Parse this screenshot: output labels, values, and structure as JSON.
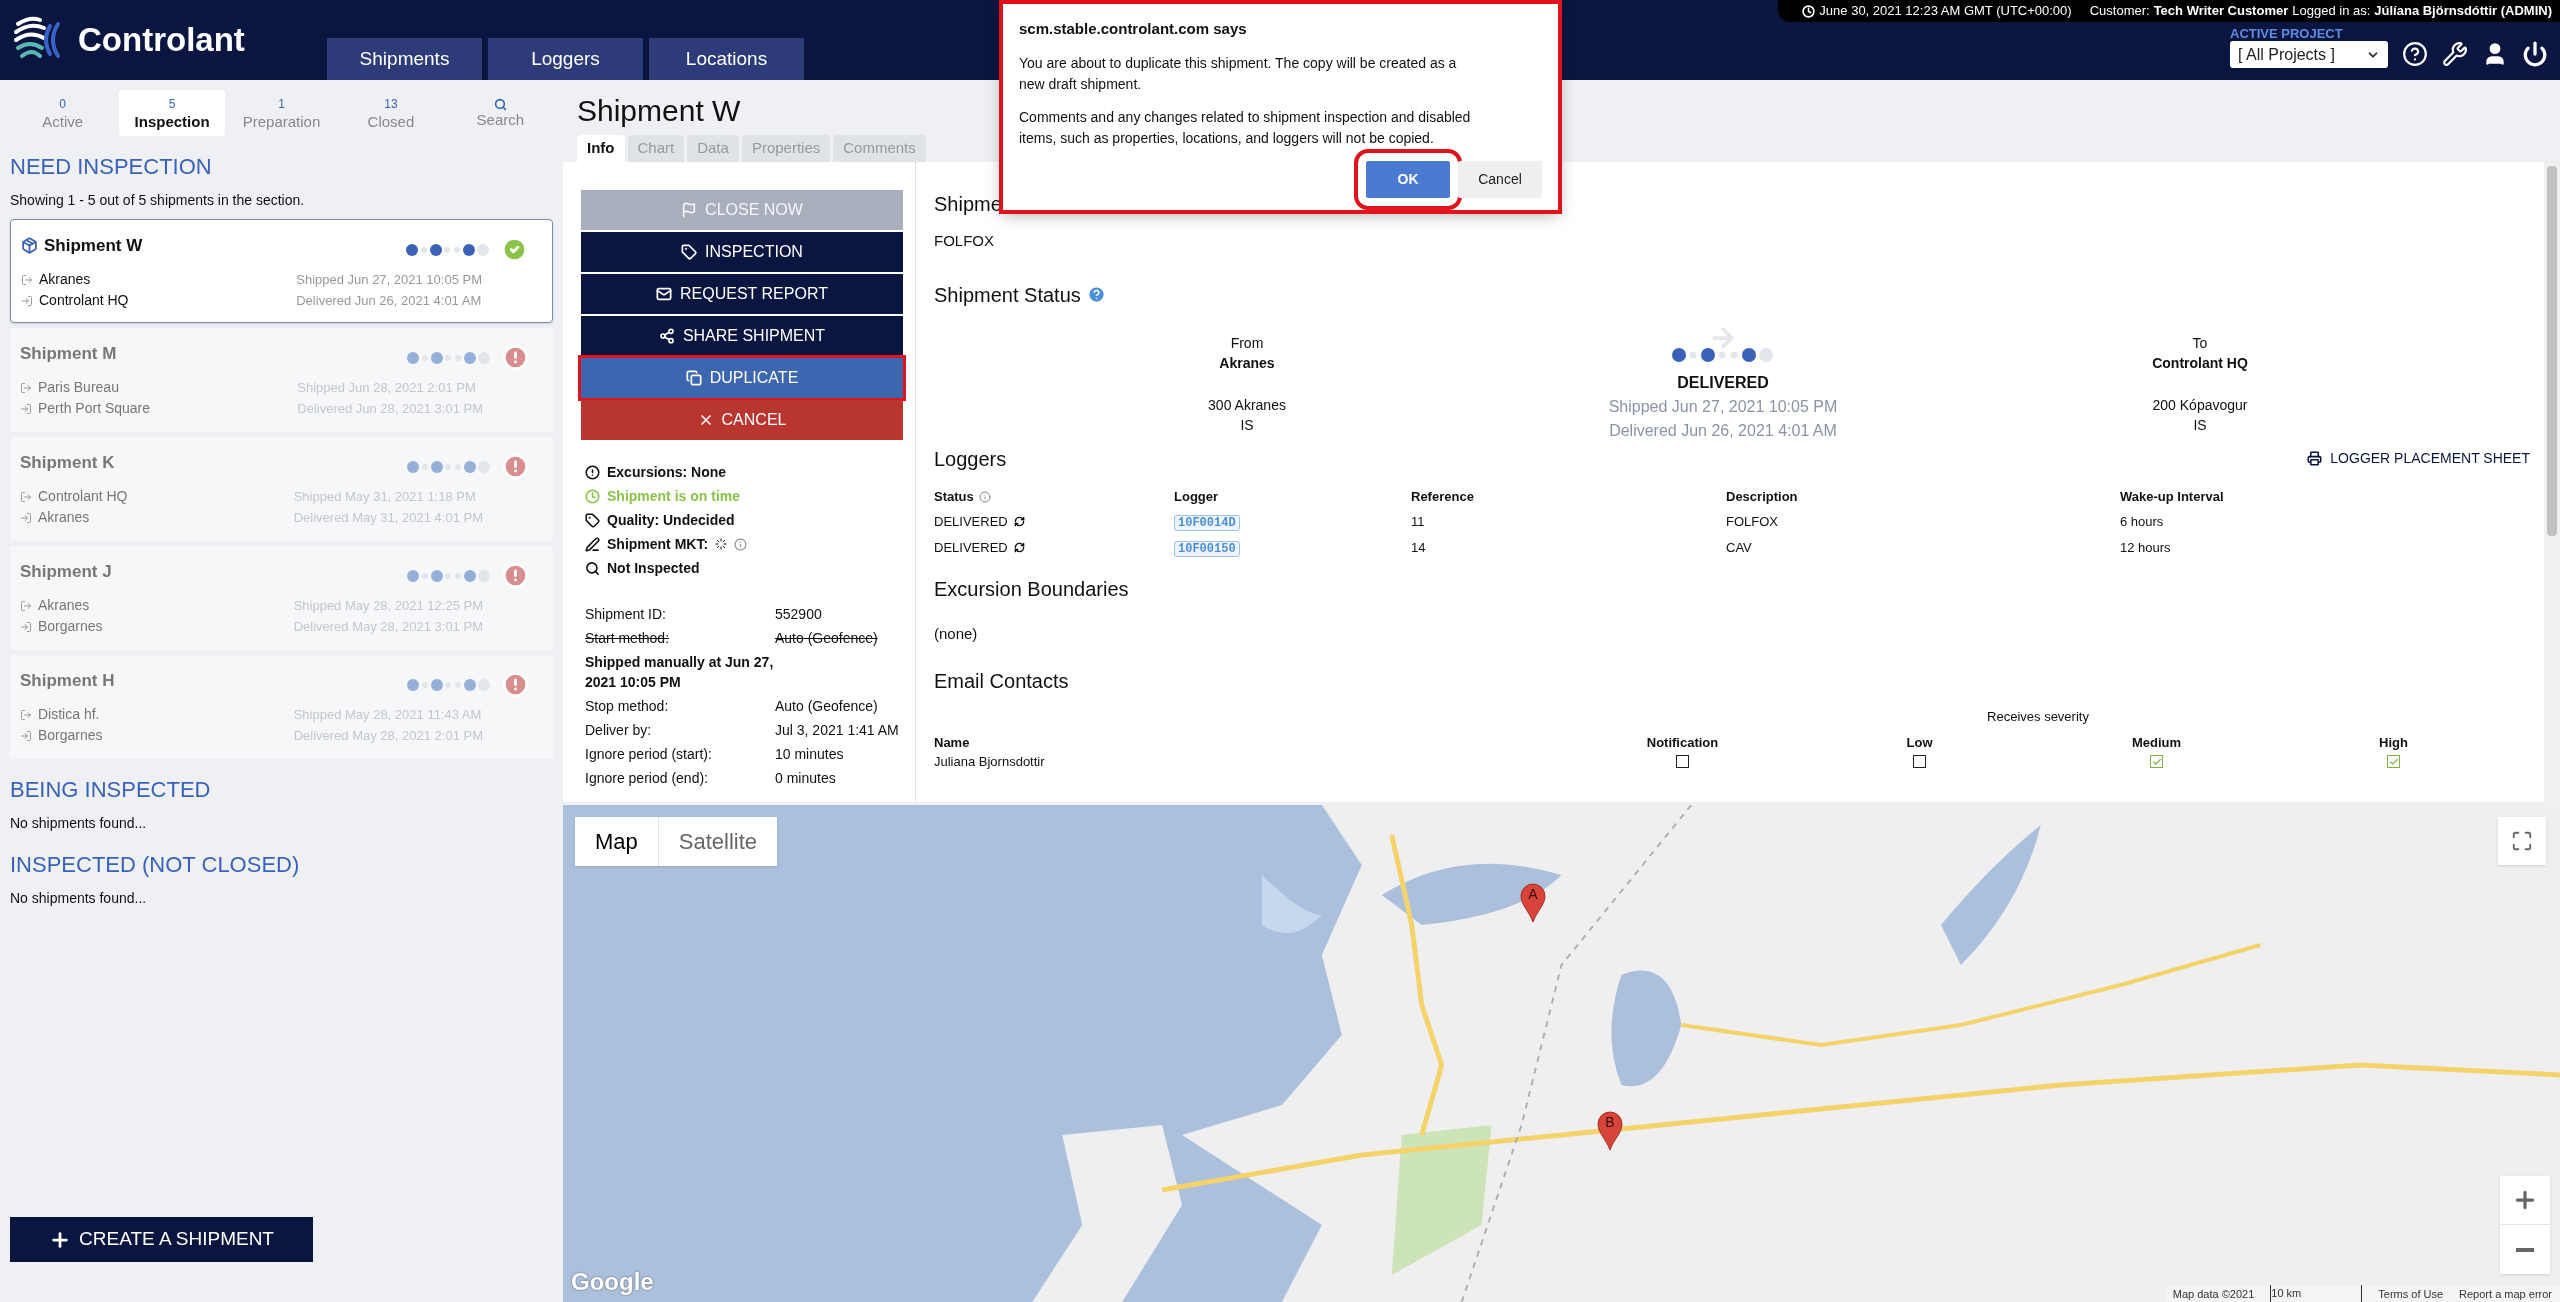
{
  "header": {
    "logo": "Controlant",
    "nav": [
      "Shipments",
      "Loggers",
      "Locations"
    ],
    "datetime": "June 30, 2021 12:23 AM GMT (UTC+00:00)",
    "customer_label": "Customer:",
    "customer": "Tech Writer Customer",
    "logged_in_label": "Logged in as:",
    "user": "Júlíana Björnsdóttir (ADMIN)",
    "project_label": "ACTIVE PROJECT",
    "project_select": "[ All Projects ]"
  },
  "sidebar": {
    "tabs": [
      {
        "kind": "count",
        "count": "0",
        "label": "Active",
        "selected": false
      },
      {
        "kind": "count",
        "count": "5",
        "label": "Inspection",
        "selected": true
      },
      {
        "kind": "count",
        "count": "1",
        "label": "Preparation",
        "selected": false
      },
      {
        "kind": "count",
        "count": "13",
        "label": "Closed",
        "selected": false
      },
      {
        "kind": "search",
        "label": "Search",
        "selected": false
      }
    ],
    "sections": [
      {
        "title": "NEED INSPECTION",
        "summary": "Showing 1 - 5 out of 5 shipments in the section.",
        "shipments": [
          {
            "name": "Shipment W",
            "from": "Akranes",
            "to": "Controlant HQ",
            "shipped": "Shipped Jun 27, 2021 10:05 PM",
            "delivered": "Delivered Jun 26, 2021 4:01 AM",
            "selected": true,
            "flagged": false
          },
          {
            "name": "Shipment M",
            "from": "Paris Bureau",
            "to": "Perth Port Square",
            "shipped": "Shipped Jun 28, 2021 2:01 PM",
            "delivered": "Delivered Jun 28, 2021 3:01 PM",
            "selected": false,
            "flagged": true
          },
          {
            "name": "Shipment K",
            "from": "Controlant HQ",
            "to": "Akranes",
            "shipped": "Shipped May 31, 2021 1:18 PM",
            "delivered": "Delivered May 31, 2021 4:01 PM",
            "selected": false,
            "flagged": true
          },
          {
            "name": "Shipment J",
            "from": "Akranes",
            "to": "Borgarnes",
            "shipped": "Shipped May 28, 2021 12:25 PM",
            "delivered": "Delivered May 28, 2021 3:01 PM",
            "selected": false,
            "flagged": true
          },
          {
            "name": "Shipment H",
            "from": "Distica hf.",
            "to": "Borgarnes",
            "shipped": "Shipped May 28, 2021 11:43 AM",
            "delivered": "Delivered May 28, 2021 2:01 PM",
            "selected": false,
            "flagged": true
          }
        ]
      },
      {
        "title": "BEING INSPECTED",
        "empty": "No shipments found..."
      },
      {
        "title": "INSPECTED (NOT CLOSED)",
        "empty": "No shipments found..."
      }
    ],
    "create_button": "CREATE A SHIPMENT"
  },
  "main": {
    "title": "Shipment W",
    "tabs": [
      {
        "label": "Info",
        "selected": true
      },
      {
        "label": "Chart",
        "selected": false
      },
      {
        "label": "Data",
        "selected": false
      },
      {
        "label": "Properties",
        "selected": false
      },
      {
        "label": "Comments",
        "selected": false
      }
    ],
    "actions": [
      {
        "kind": "close",
        "label": "CLOSE NOW",
        "disabled": true,
        "highlighted": false
      },
      {
        "kind": "inspection",
        "label": "INSPECTION",
        "disabled": false,
        "highlighted": false
      },
      {
        "kind": "report",
        "label": "REQUEST REPORT",
        "disabled": false,
        "highlighted": false
      },
      {
        "kind": "share",
        "label": "SHARE SHIPMENT",
        "disabled": false,
        "highlighted": false
      },
      {
        "kind": "duplicate",
        "label": "DUPLICATE",
        "disabled": false,
        "highlighted": true
      },
      {
        "kind": "cancel",
        "label": "CANCEL",
        "disabled": false,
        "highlighted": false
      }
    ],
    "status_list": [
      {
        "kind": "excursions",
        "text": "Excursions: None"
      },
      {
        "kind": "on_time",
        "text": "Shipment is on time"
      },
      {
        "kind": "quality",
        "text": "Quality: Undecided"
      },
      {
        "kind": "mkt",
        "text": "Shipment MKT:"
      },
      {
        "kind": "inspected",
        "text": "Not Inspected"
      }
    ],
    "details": [
      {
        "kind": "row",
        "label": "Shipment ID:",
        "value": "552900",
        "struck": false
      },
      {
        "kind": "row",
        "label": "Start method:",
        "value": "Auto (Geofence)",
        "struck": true
      },
      {
        "kind": "note",
        "text": "Shipped manually at Jun 27, 2021 10:05 PM"
      },
      {
        "kind": "row",
        "label": "Stop method:",
        "value": "Auto (Geofence)",
        "struck": false
      },
      {
        "kind": "row",
        "label": "Deliver by:",
        "value": "Jul 3, 2021 1:41 AM",
        "struck": false
      },
      {
        "kind": "row",
        "label": "Ignore period (start):",
        "value": "10 minutes",
        "struck": false
      },
      {
        "kind": "row",
        "label": "Ignore period (end):",
        "value": "0 minutes",
        "struck": false
      }
    ],
    "shipment_heading": "Shipme",
    "description": "FOLFOX",
    "status": {
      "heading": "Shipment Status",
      "from": {
        "label": "From",
        "name": "Akranes",
        "address": "300 Akranes",
        "country": "IS"
      },
      "state": "DELIVERED",
      "shipped": "Shipped Jun 27, 2021 10:05 PM",
      "delivered": "Delivered Jun 26, 2021 4:01 AM",
      "to": {
        "label": "To",
        "name": "Controlant HQ",
        "address": "200 Kópavogur",
        "country": "IS"
      }
    },
    "loggers": {
      "heading": "Loggers",
      "placement_button": "LOGGER PLACEMENT SHEET",
      "columns": [
        "Status",
        "Logger",
        "Reference",
        "Description",
        "Wake-up Interval"
      ],
      "rows": [
        [
          "DELIVERED",
          "10F0014D",
          "11",
          "FOLFOX",
          "6 hours"
        ],
        [
          "DELIVERED",
          "10F00150",
          "14",
          "CAV",
          "12 hours"
        ]
      ]
    },
    "excursion_boundaries": {
      "heading": "Excursion Boundaries",
      "value": "(none)"
    },
    "email_contacts": {
      "heading": "Email Contacts",
      "group_label": "Receives severity",
      "columns": [
        "Name",
        "Notification",
        "Low",
        "Medium",
        "High"
      ],
      "rows": [
        {
          "name": "Juliana Bjornsdottir",
          "notification": false,
          "low": false,
          "medium": true,
          "high": true
        }
      ]
    }
  },
  "map": {
    "type_buttons": [
      {
        "label": "Map",
        "selected": true
      },
      {
        "label": "Satellite",
        "selected": false
      }
    ],
    "markers": [
      "A",
      "B"
    ],
    "logo": "Google",
    "attribution": [
      "Map data ©2021",
      "10 km",
      "Terms of Use",
      "Report a map error"
    ]
  },
  "dialog": {
    "title": "scm.stable.controlant.com says",
    "paragraphs": [
      "You are about to duplicate this shipment. The copy will be created as a new draft shipment.",
      "Comments and any changes related to shipment inspection and disabled items, such as properties, locations, and loggers will not be copied."
    ],
    "highlighted": true,
    "buttons": [
      {
        "kind": "primary",
        "label": "OK",
        "highlighted": true
      },
      {
        "kind": "secondary",
        "label": "Cancel",
        "highlighted": false
      }
    ]
  }
}
